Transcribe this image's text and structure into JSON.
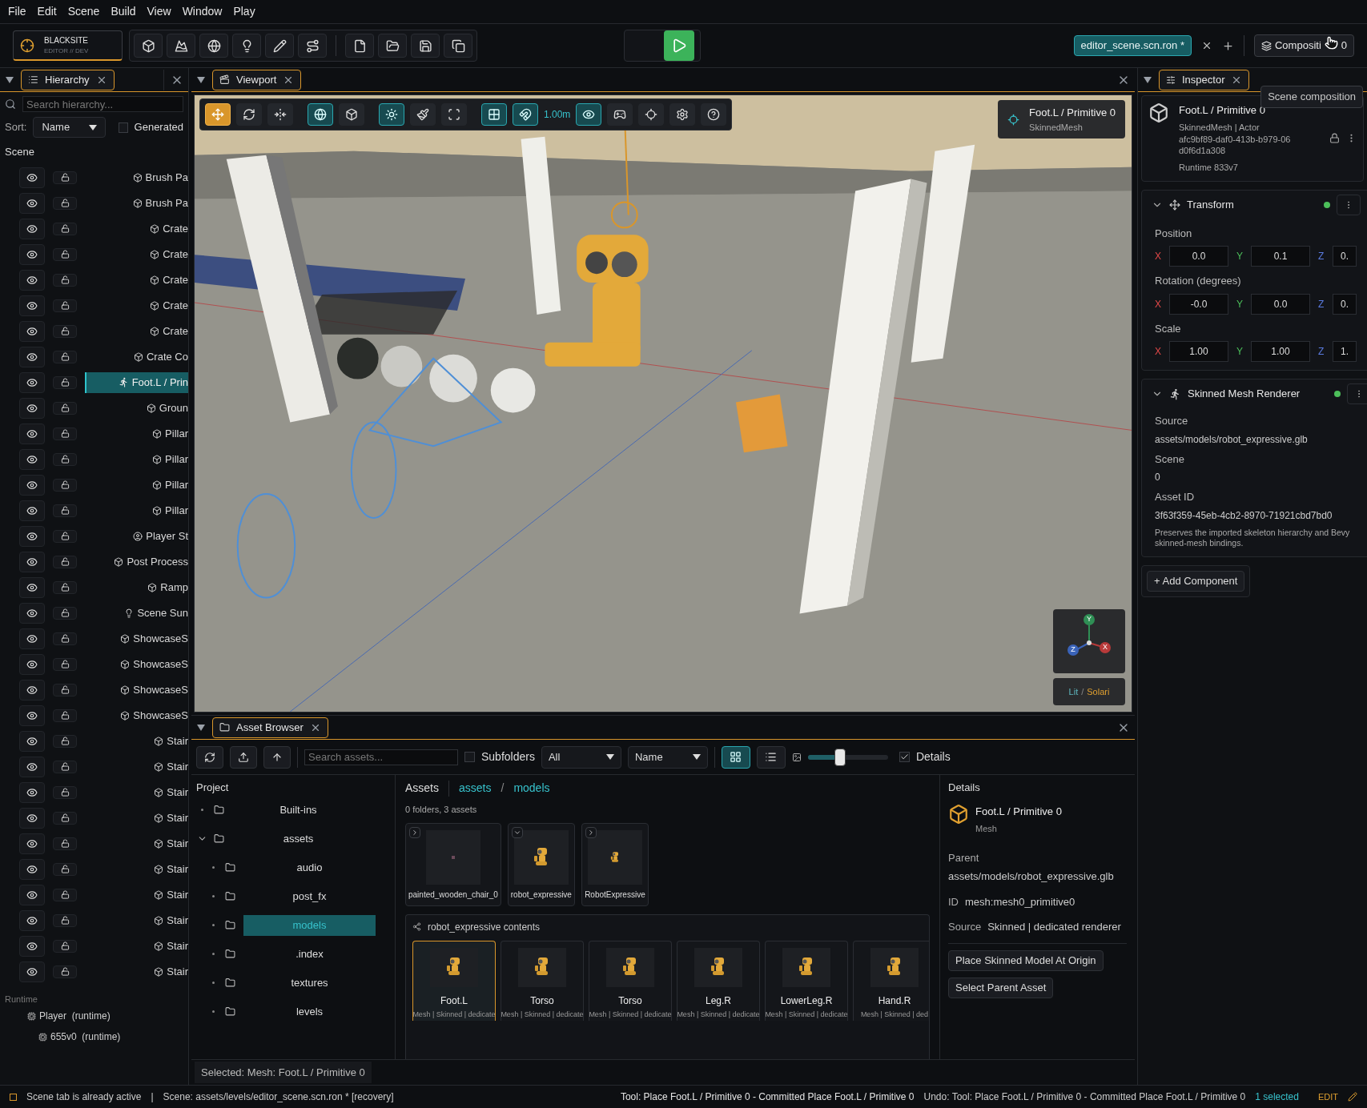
{
  "menu": [
    "File",
    "Edit",
    "Scene",
    "Build",
    "View",
    "Window",
    "Play"
  ],
  "brand": {
    "title": "BLACKSITE",
    "subtitle": "EDITOR // DEV"
  },
  "scene_tabs": [
    {
      "label": "editor_scene.scn.ron *",
      "selected": true
    }
  ],
  "composition_button": {
    "label": "Compositi",
    "count": "0",
    "tooltip": "Scene composition"
  },
  "hierarchy": {
    "tab": "Hierarchy",
    "search_placeholder": "Search hierarchy...",
    "sort_label": "Sort:",
    "sort_value": "Name",
    "generated": {
      "label": "Generated",
      "checked": false
    },
    "scene_label": "Scene",
    "items": [
      {
        "name": "Brush Pa",
        "kind": "mesh",
        "selected": false,
        "locked": false
      },
      {
        "name": "Brush Pa",
        "kind": "mesh",
        "selected": false,
        "locked": false
      },
      {
        "name": "Crate",
        "kind": "mesh",
        "selected": false,
        "locked": false
      },
      {
        "name": "Crate",
        "kind": "mesh",
        "selected": false,
        "locked": false
      },
      {
        "name": "Crate",
        "kind": "mesh",
        "selected": false,
        "locked": false
      },
      {
        "name": "Crate",
        "kind": "mesh",
        "selected": false,
        "locked": false
      },
      {
        "name": "Crate",
        "kind": "mesh",
        "selected": false,
        "locked": false
      },
      {
        "name": "Crate Co",
        "kind": "mesh",
        "selected": false,
        "locked": false
      },
      {
        "name": "Foot.L / Prin",
        "kind": "actor",
        "selected": true,
        "locked": false
      },
      {
        "name": "Groun",
        "kind": "mesh",
        "selected": false,
        "locked": false
      },
      {
        "name": "Pillar",
        "kind": "mesh",
        "selected": false,
        "locked": false
      },
      {
        "name": "Pillar",
        "kind": "mesh",
        "selected": false,
        "locked": false
      },
      {
        "name": "Pillar",
        "kind": "mesh",
        "selected": false,
        "locked": false
      },
      {
        "name": "Pillar",
        "kind": "mesh",
        "selected": false,
        "locked": false
      },
      {
        "name": "Player St",
        "kind": "player",
        "selected": false,
        "locked": false
      },
      {
        "name": "Post Process",
        "kind": "mesh",
        "selected": false,
        "locked": false
      },
      {
        "name": "Ramp",
        "kind": "mesh",
        "selected": false,
        "locked": false
      },
      {
        "name": "Scene Sun",
        "kind": "light",
        "selected": false,
        "locked": false
      },
      {
        "name": "ShowcaseS",
        "kind": "mesh",
        "selected": false,
        "locked": false
      },
      {
        "name": "ShowcaseS",
        "kind": "mesh",
        "selected": false,
        "locked": false
      },
      {
        "name": "ShowcaseS",
        "kind": "mesh",
        "selected": false,
        "locked": false
      },
      {
        "name": "ShowcaseS",
        "kind": "mesh",
        "selected": false,
        "locked": false
      },
      {
        "name": "Stair",
        "kind": "mesh",
        "selected": false,
        "locked": false
      },
      {
        "name": "Stair",
        "kind": "mesh",
        "selected": false,
        "locked": false
      },
      {
        "name": "Stair",
        "kind": "mesh",
        "selected": false,
        "locked": false
      },
      {
        "name": "Stair",
        "kind": "mesh",
        "selected": false,
        "locked": false
      },
      {
        "name": "Stair",
        "kind": "mesh",
        "selected": false,
        "locked": false
      },
      {
        "name": "Stair",
        "kind": "mesh",
        "selected": false,
        "locked": false
      },
      {
        "name": "Stair",
        "kind": "mesh",
        "selected": false,
        "locked": false
      },
      {
        "name": "Stair",
        "kind": "mesh",
        "selected": false,
        "locked": false
      },
      {
        "name": "Stair",
        "kind": "mesh",
        "selected": false,
        "locked": false
      },
      {
        "name": "Stair",
        "kind": "mesh",
        "selected": false,
        "locked": false
      }
    ],
    "runtime_label": "Runtime",
    "runtime_items": [
      {
        "name": "Player  (runtime)",
        "children": [
          {
            "name": "655v0  (runtime)"
          }
        ]
      }
    ]
  },
  "viewport": {
    "tab": "Viewport",
    "toolbar": [
      {
        "kind": "move",
        "selected": true
      },
      {
        "kind": "rotate",
        "selected": false
      },
      {
        "kind": "scale",
        "selected": false
      },
      {
        "kind": "divider"
      },
      {
        "kind": "world",
        "on": true
      },
      {
        "kind": "local",
        "on": false
      },
      {
        "kind": "divider"
      },
      {
        "kind": "light",
        "on": true
      },
      {
        "kind": "paint",
        "on": false
      },
      {
        "kind": "bounds",
        "on": false
      },
      {
        "kind": "divider"
      },
      {
        "kind": "grid",
        "on": true
      },
      {
        "kind": "snap",
        "on": true
      },
      {
        "kind": "readout",
        "text": "1.00m"
      },
      {
        "kind": "visibility",
        "on": true
      },
      {
        "kind": "gamepad",
        "on": false
      },
      {
        "kind": "focus",
        "on": false
      },
      {
        "kind": "settings",
        "on": false
      },
      {
        "kind": "help",
        "on": false
      }
    ],
    "selection": {
      "title": "Foot.L / Primitive 0",
      "subtitle": "SkinnedMesh"
    },
    "gizmo_axes": [
      {
        "label": "Y",
        "color": "#2f8f55"
      },
      {
        "label": "Z",
        "color": "#3a63b8"
      },
      {
        "label": "X",
        "color": "#b83a3a"
      }
    ],
    "render_modes": [
      {
        "label": "Lit",
        "selected": false
      },
      {
        "label": "Solari",
        "selected": true
      }
    ],
    "mode_separator": "/"
  },
  "inspector": {
    "tab": "Inspector",
    "header": {
      "title": "Foot.L / Primitive 0",
      "subtitle": "SkinnedMesh | Actor",
      "id": "afc9bf89-daf0-413b-b979-06d0f6d1a308",
      "runtime": "Runtime 833v7"
    },
    "components": [
      {
        "kind": "transform",
        "title": "Transform",
        "expanded": true,
        "enabled": true,
        "fields": [
          {
            "label": "Position",
            "values": [
              {
                "axis": "X",
                "value": "0.0"
              },
              {
                "axis": "Y",
                "value": "0.1"
              },
              {
                "axis": "Z",
                "value": "0."
              }
            ]
          },
          {
            "label": "Rotation (degrees)",
            "values": [
              {
                "axis": "X",
                "value": "-0.0"
              },
              {
                "axis": "Y",
                "value": "0.0"
              },
              {
                "axis": "Z",
                "value": "0."
              }
            ]
          },
          {
            "label": "Scale",
            "values": [
              {
                "axis": "X",
                "value": "1.00"
              },
              {
                "axis": "Y",
                "value": "1.00"
              },
              {
                "axis": "Z",
                "value": "1."
              }
            ]
          }
        ]
      },
      {
        "kind": "skinned_mesh",
        "title": "Skinned Mesh Renderer",
        "expanded": true,
        "enabled": true,
        "properties": [
          {
            "label": "Source",
            "value": "assets/models/robot_expressive.glb"
          },
          {
            "label": "Scene",
            "value": "0"
          },
          {
            "label": "Asset ID",
            "value": "3f63f359-45eb-4cb2-8970-71921cbd7bd0"
          }
        ],
        "note": "Preserves the imported skeleton hierarchy and Bevy skinned-mesh bindings."
      }
    ],
    "add_button": "+ Add Component"
  },
  "asset_browser": {
    "tab": "Asset Browser",
    "search_placeholder": "Search assets...",
    "subfolders": {
      "label": "Subfolders",
      "checked": false
    },
    "filter": "All",
    "sort": "Name",
    "view_modes": [
      {
        "kind": "grid",
        "selected": true
      },
      {
        "kind": "list",
        "selected": false
      }
    ],
    "size_slider": {
      "level": 0.4
    },
    "details_toggle": {
      "label": "Details",
      "checked": true
    },
    "project": {
      "title": "Project",
      "tree": [
        {
          "name": "Built-ins",
          "selected": false
        },
        {
          "name": "assets",
          "selected": false,
          "expanded": true,
          "children": [
            {
              "name": "audio",
              "selected": false
            },
            {
              "name": "post_fx",
              "selected": false
            },
            {
              "name": "models",
              "selected": true
            },
            {
              "name": ".index",
              "selected": false
            },
            {
              "name": "textures",
              "selected": false
            },
            {
              "name": "levels",
              "selected": false
            }
          ]
        }
      ]
    },
    "assets": {
      "title": "Assets",
      "breadcrumb": [
        "assets",
        "models"
      ],
      "breadcrumb_separator": "/",
      "count": "0 folders, 3 assets",
      "items": [
        {
          "name": "painted_wooden_chair_0",
          "kind": "chair",
          "expanded": false
        },
        {
          "name": "robot_expressive",
          "kind": "robot",
          "expanded": true
        },
        {
          "name": "RobotExpressive",
          "kind": "robot_small",
          "expanded": false
        }
      ],
      "contents": {
        "title": "robot_expressive contents",
        "items": [
          {
            "name": "Foot.L",
            "subtitle": "Mesh | Skinned | dedicate",
            "selected": true
          },
          {
            "name": "Torso",
            "subtitle": "Mesh | Skinned | dedicate",
            "selected": false
          },
          {
            "name": "Torso",
            "subtitle": "Mesh | Skinned | dedicate",
            "selected": false
          },
          {
            "name": "Leg.R",
            "subtitle": "Mesh | Skinned | dedicate",
            "selected": false
          },
          {
            "name": "LowerLeg.R",
            "subtitle": "Mesh | Skinned | dedicate",
            "selected": false
          },
          {
            "name": "Hand.R",
            "subtitle": "Mesh | Skinned | ded",
            "selected": false
          }
        ]
      }
    },
    "details": {
      "title": "Details",
      "name": "Foot.L / Primitive 0",
      "type": "Mesh",
      "parent_label": "Parent",
      "parent": "assets/models/robot_expressive.glb",
      "rows": [
        {
          "label": "ID",
          "value": "mesh:mesh0_primitive0"
        },
        {
          "label": "Source",
          "value": "Skinned | dedicated renderer"
        }
      ],
      "buttons": [
        "Place Skinned Model At Origin",
        "Select Parent Asset"
      ]
    },
    "footer": "Selected: Mesh: Foot.L / Primitive 0"
  },
  "status_bar": {
    "message": "Scene tab is already active",
    "separator": "|",
    "scene": "Scene: assets/levels/editor_scene.scn.ron * [recovery]",
    "tool": "Tool: Place Foot.L / Primitive 0 - Committed Place Foot.L / Primitive 0",
    "undo": "Undo: Tool: Place Foot.L / Primitive 0 - Committed Place Foot.L / Primitive 0",
    "selection": "1 selected",
    "mode": "EDIT"
  }
}
